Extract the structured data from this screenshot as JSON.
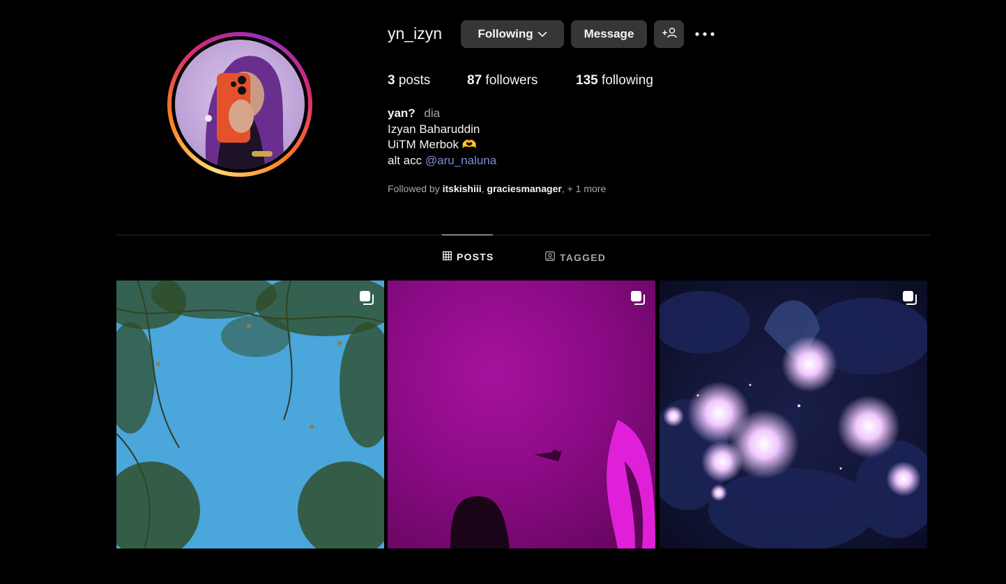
{
  "profile": {
    "username": "yn_izyn",
    "buttons": {
      "following": "Following",
      "message": "Message",
      "add_user": "+"
    },
    "stats": {
      "posts_count": "3",
      "posts_label": "posts",
      "followers_count": "87",
      "followers_label": "followers",
      "following_count": "135",
      "following_label": "following"
    },
    "bio": {
      "name": "yan?",
      "pronoun": "dia",
      "line1": "Izyan Baharuddin",
      "line2": "UiTM Merbok 🫶",
      "line3_prefix": "alt acc",
      "line3_link": "@aru_naluna"
    },
    "followed_by": {
      "prefix": "Followed by",
      "user1": "itskishiii",
      "sep": ",",
      "user2": "graciesmanager",
      "suffix": ", + 1 more"
    }
  },
  "tabs": [
    {
      "label": "POSTS",
      "active": true,
      "icon": "grid-icon"
    },
    {
      "label": "TAGGED",
      "active": false,
      "icon": "tagged-icon"
    }
  ],
  "posts": [
    {
      "subject": "tree-branches-blue-sky",
      "multi": true,
      "accent": "#4aa6db"
    },
    {
      "subject": "magenta-silhouette",
      "multi": true,
      "accent": "#a5129c"
    },
    {
      "subject": "glowing-lotus-flowers",
      "multi": true,
      "accent": "#1a1f4a"
    }
  ],
  "colors": {
    "background": "#000000",
    "button": "#363636",
    "link": "#7f8cdd",
    "muted": "#a8a8a8"
  }
}
